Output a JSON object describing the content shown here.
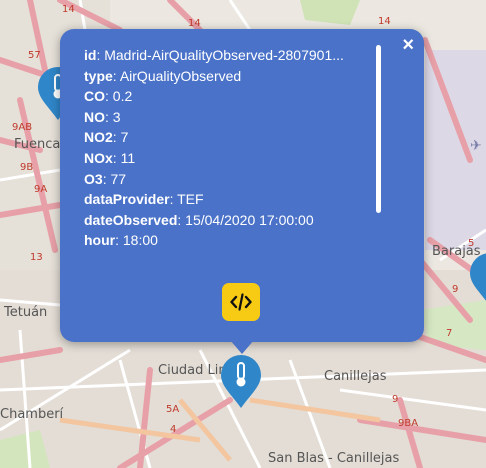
{
  "map": {
    "place_labels": [
      "Fuencarral",
      "Tetuán",
      "Barajas",
      "Ciudad Lineal",
      "Canillejas",
      "Chamberí",
      "San Blas - Canillejas"
    ],
    "road_labels": [
      "14",
      "14",
      "57",
      "9AB",
      "9B",
      "9A",
      "13",
      "5",
      "9",
      "7",
      "5A",
      "4",
      "9BA",
      "9",
      "14"
    ]
  },
  "popup": {
    "close_label": "×",
    "fields": [
      {
        "key": "id",
        "value": "Madrid-AirQualityObserved-2807901..."
      },
      {
        "key": "type",
        "value": "AirQualityObserved"
      },
      {
        "key": "CO",
        "value": "0.2"
      },
      {
        "key": "NO",
        "value": "3"
      },
      {
        "key": "NO2",
        "value": "7"
      },
      {
        "key": "NOx",
        "value": "11"
      },
      {
        "key": "O3",
        "value": "77"
      },
      {
        "key": "dataProvider",
        "value": "TEF"
      },
      {
        "key": "dateObserved",
        "value": "15/04/2020 17:00:00"
      },
      {
        "key": "hour",
        "value": "18:00"
      }
    ],
    "code_button_icon": "code-icon"
  },
  "colors": {
    "popup_bg": "#4a72c8",
    "marker": "#2f86c9",
    "code_button": "#f7cb14"
  },
  "markers": [
    {
      "name": "thermometer-marker-fuencarral",
      "icon": "thermometer-icon"
    },
    {
      "name": "thermometer-marker-ciudad-lineal",
      "icon": "thermometer-icon"
    },
    {
      "name": "thermometer-marker-east",
      "icon": "thermometer-icon"
    }
  ]
}
